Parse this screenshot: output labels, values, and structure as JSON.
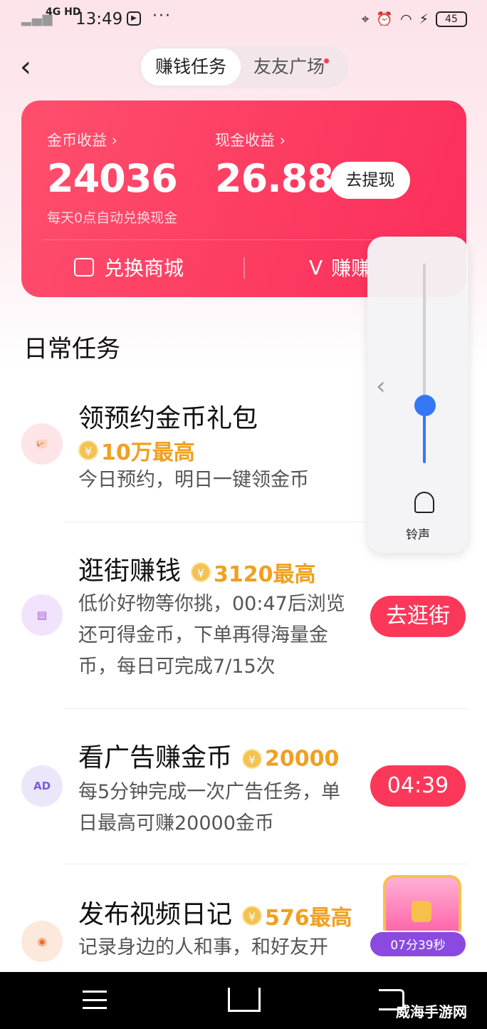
{
  "status_bar": {
    "network": "4G HD",
    "time": "13:49",
    "more": "···",
    "battery": "45"
  },
  "tabs": {
    "active": "赚钱任务",
    "inactive": "友友广场"
  },
  "earnings_card": {
    "coin_label": "金币收益 ›",
    "coin_value": "24036",
    "cash_label": "现金收益 ›",
    "cash_value": "26.88",
    "withdraw": "去提现",
    "note": "每天0点自动兑换现金",
    "mall": "兑换商城",
    "earn": "赚赚"
  },
  "section_title": "日常任务",
  "tasks": [
    {
      "title": "领预约金币礼包",
      "reward": "10万最高",
      "desc": "今日预约，明日一键领金币",
      "icon": "piggy-bank-icon",
      "button": ""
    },
    {
      "title": "逛街赚钱",
      "reward": "3120最高",
      "desc": "低价好物等你挑，00:47后浏览还可得金币，下单再得海量金币，每日可完成7/15次",
      "icon": "shop-icon",
      "button": "去逛街"
    },
    {
      "title": "看广告赚金币",
      "reward": "20000",
      "desc": "每5分钟完成一次广告任务，单日最高可赚20000金币",
      "icon_text": "AD",
      "button": "04:39"
    },
    {
      "title": "发布视频日记",
      "reward": "576最高",
      "desc": "记录身边的人和事，和好友开",
      "icon": "camera-icon",
      "button": ""
    }
  ],
  "coin_symbol": "¥",
  "volume_panel": {
    "label": "铃声",
    "level": 0.3
  },
  "chest_timer": "07分39秒",
  "watermark": "威海手游网",
  "colors": {
    "accent": "#fb3859",
    "coin": "#f0a020",
    "volume": "#3478f6"
  }
}
